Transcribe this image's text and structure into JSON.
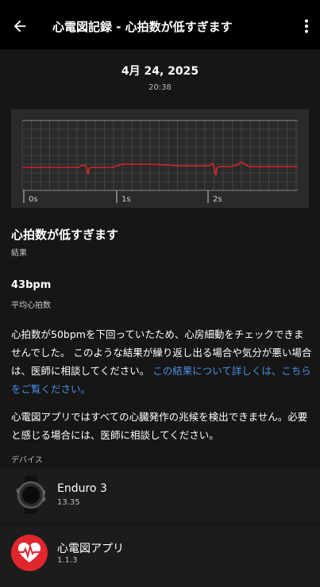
{
  "header": {
    "title": "心電図記録 - 心拍数が低すぎます"
  },
  "record": {
    "date": "4月 24, 2025",
    "time": "20:38"
  },
  "ecg": {
    "time_labels": [
      "0s",
      "1s",
      "2s"
    ],
    "line_color": "#d8232a"
  },
  "result": {
    "value": "心拍数が低すぎます",
    "label": "結果"
  },
  "heart_rate": {
    "value": "43bpm",
    "label": "平均心拍数"
  },
  "description": {
    "text": "心拍数が50bpmを下回っていたため、心房細動をチェックできませんでした。 このような結果が繰り返し出る場合や気分が悪い場合は、医師に相談してください。 ",
    "link": "この結果について詳しくは、こちらをご覧ください。"
  },
  "disclaimer": "心電図アプリではすべての心臓発作の兆候を検出できません。必要と感じる場合には、医師に相談してください。",
  "devices": {
    "section_label": "デバイス",
    "items": [
      {
        "name": "Enduro 3",
        "version": "13.35",
        "icon": "watch-icon"
      },
      {
        "name": "心電図アプリ",
        "version": "1.1.3",
        "icon": "ecg-app-icon"
      }
    ]
  },
  "colors": {
    "accent_link": "#4a90e2",
    "app_icon_red": "#e1262d"
  }
}
